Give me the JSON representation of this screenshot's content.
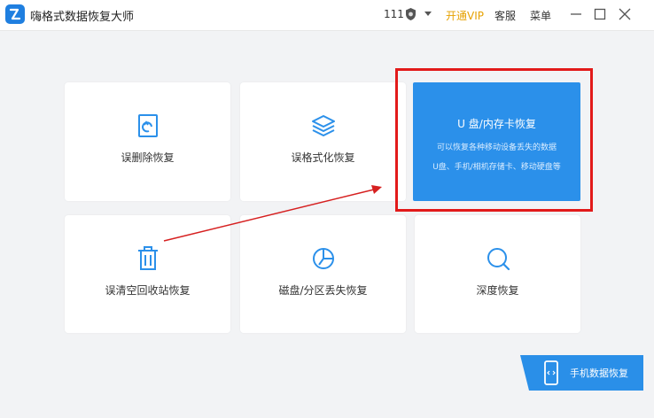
{
  "titlebar": {
    "app_title": "嗨格式数据恢复大师",
    "count": "111",
    "vip_label": "开通VIP",
    "service_label": "客服",
    "menu_label": "菜单"
  },
  "cards": {
    "deleted": "误删除恢复",
    "formatted": "误格式化恢复",
    "recycle": "误清空回收站恢复",
    "partition": "磁盘/分区丢失恢复",
    "deep": "深度恢复"
  },
  "usb_card": {
    "title": "U 盘/内存卡恢复",
    "line1": "可以恢复各种移动设备丢失的数据",
    "line2": "U盘、手机/相机存储卡、移动硬盘等"
  },
  "phone_button": {
    "label": "手机数据恢复"
  },
  "colors": {
    "accent_blue": "#2b90ea",
    "vip_gold": "#e6a100",
    "highlight_red": "#e21a1a"
  }
}
